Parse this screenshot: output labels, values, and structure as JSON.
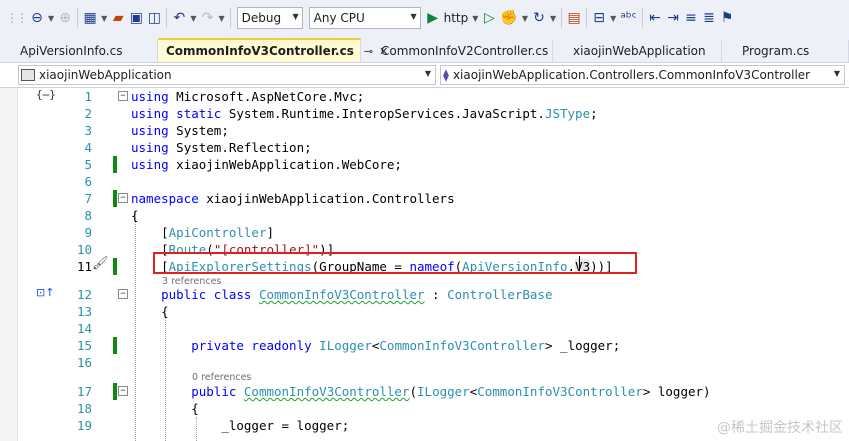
{
  "toolbar": {
    "configuration": "Debug",
    "platform": "Any CPU",
    "run_label": "http"
  },
  "tabs": [
    {
      "label": "ApiVersionInfo.cs",
      "active": false
    },
    {
      "label": "CommonInfoV3Controller.cs",
      "active": true,
      "pin_glyph": "⊸",
      "close_glyph": "✕"
    },
    {
      "label": "CommonInfoV2Controller.cs",
      "active": false
    },
    {
      "label": "xiaojinWebApplication",
      "active": false
    },
    {
      "label": "Program.cs",
      "active": false
    }
  ],
  "navbar": {
    "project": "xiaojinWebApplication",
    "type": "xiaojinWebApplication.Controllers.CommonInfoV3Controller"
  },
  "editor": {
    "current_line": 11,
    "lines": [
      {
        "num": "1"
      },
      {
        "num": "2"
      },
      {
        "num": "3"
      },
      {
        "num": "4"
      },
      {
        "num": "5"
      },
      {
        "num": "6"
      },
      {
        "num": "7"
      },
      {
        "num": "8"
      },
      {
        "num": "9"
      },
      {
        "num": "10"
      },
      {
        "num": "11"
      },
      {
        "num": "12"
      },
      {
        "num": "13"
      },
      {
        "num": "14"
      },
      {
        "num": "15"
      },
      {
        "num": "16"
      },
      {
        "num": "17"
      },
      {
        "num": "18"
      },
      {
        "num": "19"
      }
    ],
    "code": {
      "l1": "using Microsoft.AspNetCore.Mvc;",
      "l2_using": "using",
      "l2_static": "static",
      "l2_ns": " System.Runtime.InteropServices.JavaScript.",
      "l2_type": "JSType",
      "l3": "System;",
      "l4": "System.Reflection;",
      "l5": "xiaojinWebApplication.WebCore;",
      "l7_kw": "namespace",
      "l7_name": " xiaojinWebApplication.Controllers",
      "l8": "{",
      "l9_attr": "ApiController",
      "l10_attr": "Route",
      "l10_str": "\"[controller]\"",
      "l11_attr": "ApiExplorerSettings",
      "l11_param": "GroupName",
      "l11_kw": "nameof",
      "l11_type": "ApiVersionInfo",
      "l11_member": "V3",
      "l12_kw": "public class",
      "l12_name": "CommonInfoV3Controller",
      "l12_base": "ControllerBase",
      "l13": "{",
      "l15_kw": "private readonly",
      "l15_type": "ILogger",
      "l15_gen": "CommonInfoV3Controller",
      "l15_field": "_logger",
      "l17_kw": "public",
      "l17_name": "CommonInfoV3Controller",
      "l17_type": "ILogger",
      "l17_gen": "CommonInfoV3Controller",
      "l17_param": "logger",
      "l18": "{",
      "l19_field": "_logger",
      "l19_param": "logger"
    },
    "codelens": {
      "class_refs": "3 references",
      "ctor_refs": "0 references"
    }
  },
  "watermark": "@稀土掘金技术社区",
  "colors": {
    "keyword": "#0000ff",
    "type": "#2b91af",
    "string": "#a31515",
    "change_bar": "#108a10",
    "highlight_box": "#e0201f",
    "active_tab": "#fffad1"
  }
}
